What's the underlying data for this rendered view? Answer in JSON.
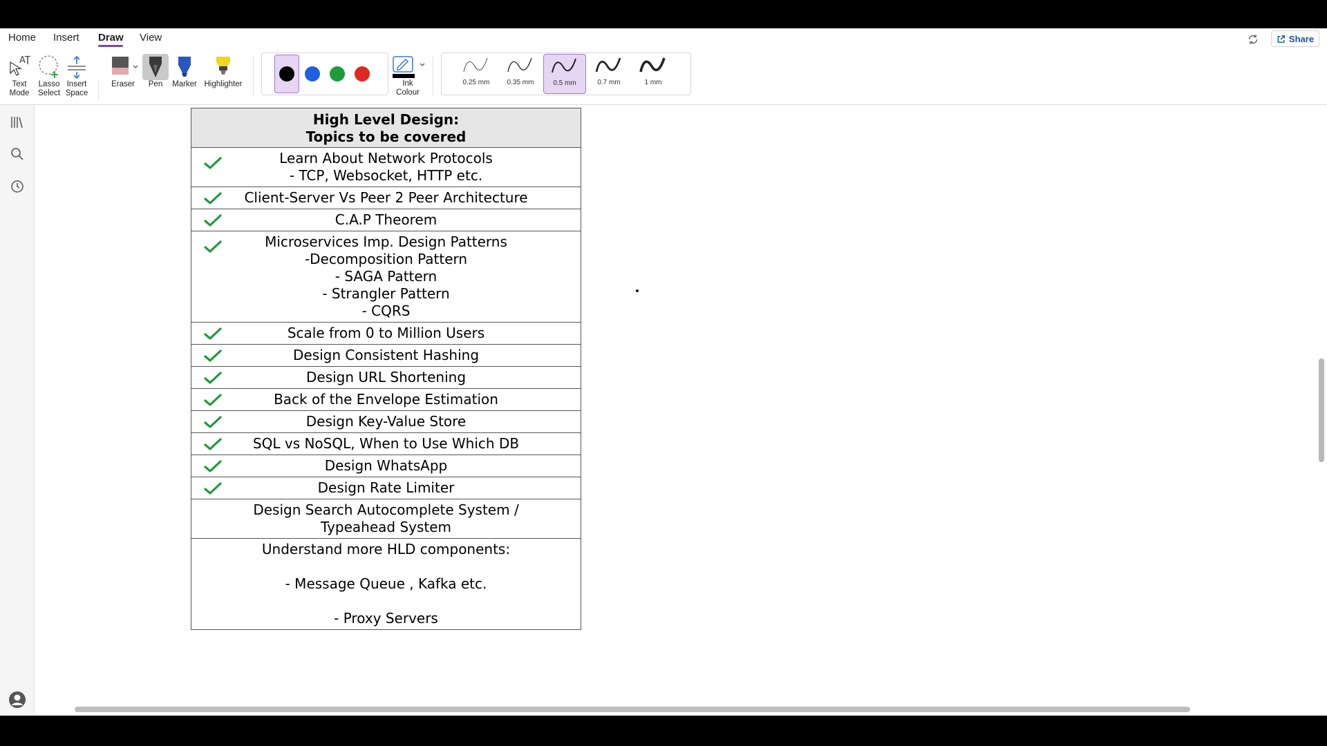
{
  "menu": {
    "tabs": [
      {
        "label": "Home"
      },
      {
        "label": "Insert"
      },
      {
        "label": "Draw"
      },
      {
        "label": "View"
      }
    ],
    "active_tab": "Draw",
    "share_label": "Share"
  },
  "ribbon": {
    "tools": {
      "text_mode": "Text\nMode",
      "lasso_select": "Lasso\nSelect",
      "insert_space": "Insert\nSpace",
      "eraser": "Eraser",
      "pen": "Pen",
      "marker": "Marker",
      "highlighter": "Highlighter",
      "ink_colour": "Ink\nColour"
    },
    "pen_colors": [
      "#000000",
      "#1f5fe0",
      "#1e9b3c",
      "#e0281f"
    ],
    "selected_color": "#000000",
    "widths": [
      "0.25 mm",
      "0.35 mm",
      "0.5 mm",
      "0.7 mm",
      "1 mm"
    ],
    "selected_width": "0.5 mm"
  },
  "note": {
    "header": [
      "High Level Design:",
      "Topics to be covered"
    ],
    "rows": [
      {
        "lines": [
          "Learn About Network Protocols",
          "- TCP, Websocket, HTTP etc."
        ],
        "checked": true
      },
      {
        "lines": [
          "Client-Server Vs Peer 2 Peer Architecture"
        ],
        "checked": true
      },
      {
        "lines": [
          "C.A.P Theorem"
        ],
        "checked": true
      },
      {
        "lines": [
          "Microservices Imp. Design Patterns",
          "-Decomposition Pattern",
          "- SAGA Pattern",
          "- Strangler Pattern",
          "- CQRS"
        ],
        "checked": true
      },
      {
        "lines": [
          "Scale from 0 to Million Users"
        ],
        "checked": true
      },
      {
        "lines": [
          "Design Consistent Hashing"
        ],
        "checked": true
      },
      {
        "lines": [
          "Design URL Shortening"
        ],
        "checked": true
      },
      {
        "lines": [
          "Back of the Envelope Estimation"
        ],
        "checked": true
      },
      {
        "lines": [
          "Design Key-Value Store"
        ],
        "checked": true
      },
      {
        "lines": [
          "SQL vs NoSQL, When to Use Which DB"
        ],
        "checked": true
      },
      {
        "lines": [
          "Design WhatsApp"
        ],
        "checked": true
      },
      {
        "lines": [
          "Design Rate Limiter"
        ],
        "checked": true
      },
      {
        "lines": [
          "Design Search Autocomplete System / Typeahead System"
        ],
        "checked": false
      },
      {
        "lines": [
          "Understand more HLD components:",
          "",
          "- Message Queue , Kafka etc.",
          "",
          "- Proxy Servers"
        ],
        "checked": false
      }
    ],
    "check_color": "#1e9b3c"
  }
}
